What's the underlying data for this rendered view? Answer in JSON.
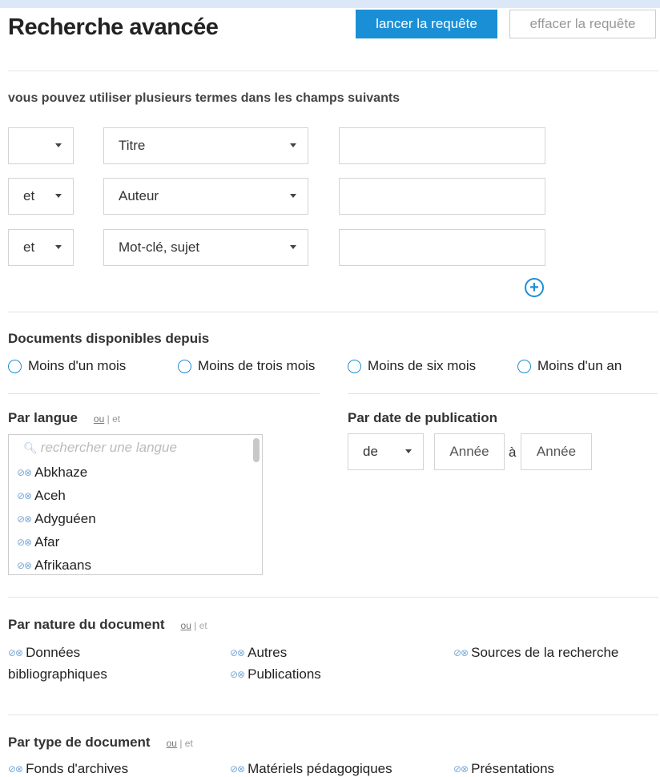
{
  "header": {
    "title": "Recherche avancée",
    "run_label": "lancer la requête",
    "clear_label": "effacer la requête"
  },
  "instructions": "vous pouvez utiliser plusieurs termes dans les champs suivants",
  "criteria": [
    {
      "operator": "",
      "field": "Titre",
      "value": ""
    },
    {
      "operator": "et",
      "field": "Auteur",
      "value": ""
    },
    {
      "operator": "et",
      "field": "Mot-clé, sujet",
      "value": ""
    }
  ],
  "availability": {
    "title": "Documents disponibles depuis",
    "options": [
      "Moins d'un mois",
      "Moins de trois mois",
      "Moins de six mois",
      "Moins d'un an"
    ]
  },
  "language": {
    "title": "Par langue",
    "ou": "ou",
    "separator": "|",
    "et": "et",
    "search_placeholder": "rechercher une langue",
    "items": [
      "Abkhaze",
      "Aceh",
      "Adyguéen",
      "Afar",
      "Afrikaans"
    ]
  },
  "pubdate": {
    "title": "Par date de publication",
    "mode": "de",
    "from_placeholder": "Année",
    "to_label": "à",
    "to_placeholder": "Année"
  },
  "nature": {
    "title": "Par nature du document",
    "ou": "ou",
    "separator": "|",
    "et": "et",
    "items": [
      "Données",
      "bibliographiques",
      "Autres",
      "Publications",
      "Sources de la recherche"
    ]
  },
  "doctype": {
    "title": "Par type de document",
    "ou": "ou",
    "separator": "|",
    "et": "et",
    "items": [
      "Fonds d'archives",
      "Matériels pédagogiques",
      "Présentations"
    ]
  },
  "icons": {
    "include_exclude": "include-exclude-icon",
    "add": "plus-circle-icon",
    "search": "search-icon",
    "caret": "chevron-down-icon"
  },
  "colors": {
    "accent": "#1a8fd6",
    "background": "#dce8f7"
  }
}
